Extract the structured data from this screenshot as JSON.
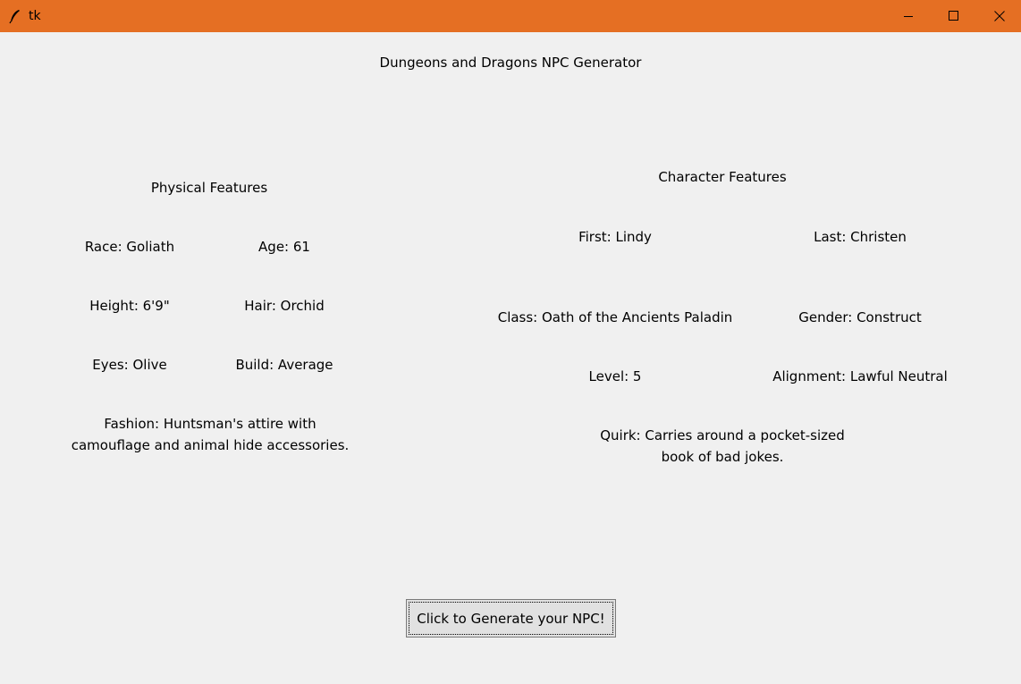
{
  "window": {
    "title": "tk",
    "titlebar_color": "#e56f23",
    "icons": {
      "app": "feather-icon",
      "minimize": "minimize-icon",
      "maximize": "maximize-icon",
      "close": "close-icon"
    }
  },
  "app": {
    "heading": "Dungeons and Dragons NPC Generator"
  },
  "physical": {
    "heading": "Physical Features",
    "race": "Race: Goliath",
    "age": "Age: 61",
    "height": "Height: 6'9\"",
    "hair": "Hair: Orchid",
    "eyes": "Eyes: Olive",
    "build": "Build: Average",
    "fashion_line1": "Fashion: Huntsman's attire with",
    "fashion_line2": "camouflage and animal hide accessories."
  },
  "character": {
    "heading": "Character Features",
    "first": "First: Lindy",
    "last": "Last: Christen",
    "class": "Class: Oath of the Ancients Paladin",
    "gender": "Gender: Construct",
    "level": "Level: 5",
    "alignment": "Alignment: Lawful Neutral",
    "quirk_line1": "Quirk: Carries around a pocket-sized",
    "quirk_line2": "book of bad jokes."
  },
  "generate_button": {
    "label": "Click to Generate your NPC!"
  }
}
